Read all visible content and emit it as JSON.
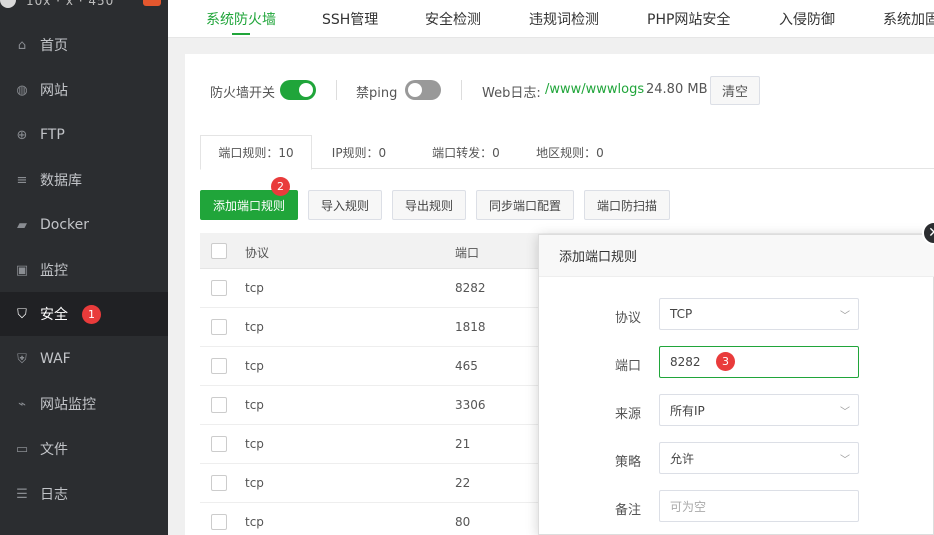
{
  "sidebar": {
    "host": "10x · x · 450",
    "items": [
      {
        "label": "首页",
        "icon": "home-icon"
      },
      {
        "label": "网站",
        "icon": "globe-icon"
      },
      {
        "label": "FTP",
        "icon": "ftp-icon"
      },
      {
        "label": "数据库",
        "icon": "database-icon"
      },
      {
        "label": "Docker",
        "icon": "docker-icon"
      },
      {
        "label": "监控",
        "icon": "monitor-icon"
      },
      {
        "label": "安全",
        "icon": "shield-icon",
        "badge": "1"
      },
      {
        "label": "WAF",
        "icon": "waf-icon"
      },
      {
        "label": "网站监控",
        "icon": "chart-icon"
      },
      {
        "label": "文件",
        "icon": "folder-icon"
      },
      {
        "label": "日志",
        "icon": "log-icon"
      }
    ]
  },
  "topbar": {
    "tabs": [
      "系统防火墙",
      "SSH管理",
      "安全检测",
      "违规词检测",
      "PHP网站安全",
      "入侵防御",
      "系统加固"
    ]
  },
  "switches": {
    "firewall_label": "防火墙开关",
    "ping_label": "禁ping",
    "weblog_label": "Web日志:",
    "weblog_path": "/www/wwwlogs",
    "weblog_size": "24.80 MB",
    "clear_label": "清空"
  },
  "subtabs": [
    "端口规则：10",
    "IP规则：0",
    "端口转发：0",
    "地区规则：0"
  ],
  "actions": {
    "add": "添加端口规则",
    "add_badge": "2",
    "import": "导入规则",
    "export": "导出规则",
    "sync": "同步端口配置",
    "scan": "端口防扫描"
  },
  "table": {
    "headers": {
      "protocol": "协议",
      "port": "端口"
    },
    "rows": [
      {
        "protocol": "tcp",
        "port": "8282"
      },
      {
        "protocol": "tcp",
        "port": "1818"
      },
      {
        "protocol": "tcp",
        "port": "465"
      },
      {
        "protocol": "tcp",
        "port": "3306"
      },
      {
        "protocol": "tcp",
        "port": "21"
      },
      {
        "protocol": "tcp",
        "port": "22"
      },
      {
        "protocol": "tcp",
        "port": "80"
      }
    ]
  },
  "modal": {
    "title": "添加端口规则",
    "protocol_label": "协议",
    "protocol_value": "TCP",
    "port_label": "端口",
    "port_value": "8282",
    "port_badge": "3",
    "source_label": "来源",
    "source_value": "所有IP",
    "policy_label": "策略",
    "policy_value": "允许",
    "note_label": "备注",
    "note_placeholder": "可为空"
  },
  "colors": {
    "accent": "#20a53a",
    "badge": "#e93b3b",
    "sidebar": "#2b2d30"
  }
}
